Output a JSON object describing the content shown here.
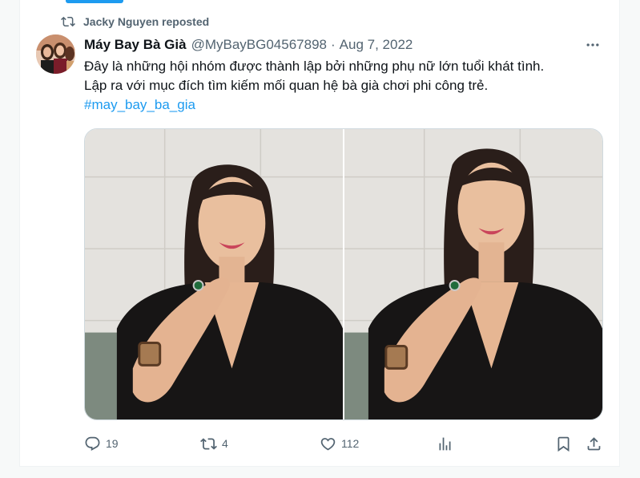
{
  "repost": {
    "text": "Jacky Nguyen reposted",
    "icon": "repost-icon"
  },
  "tweet": {
    "author_name": "Máy Bay Bà Già",
    "handle": "@MyBayBG04567898",
    "separator": "·",
    "date": "Aug 7, 2022",
    "text_line1": "Đây là những hội nhóm được thành lập bởi những phụ nữ lớn tuổi khát tình.",
    "text_line2": "Lập ra với mục đích tìm kiếm mối quan hệ bà già chơi phi công trẻ.",
    "hashtag": "#may_bay_ba_gia",
    "media_count": 2
  },
  "actions": {
    "replies": "19",
    "reposts": "4",
    "likes": "112"
  },
  "colors": {
    "accent": "#1d9bf0",
    "secondary_text": "#536471",
    "primary_text": "#0f1419",
    "border": "#cfd9de"
  }
}
